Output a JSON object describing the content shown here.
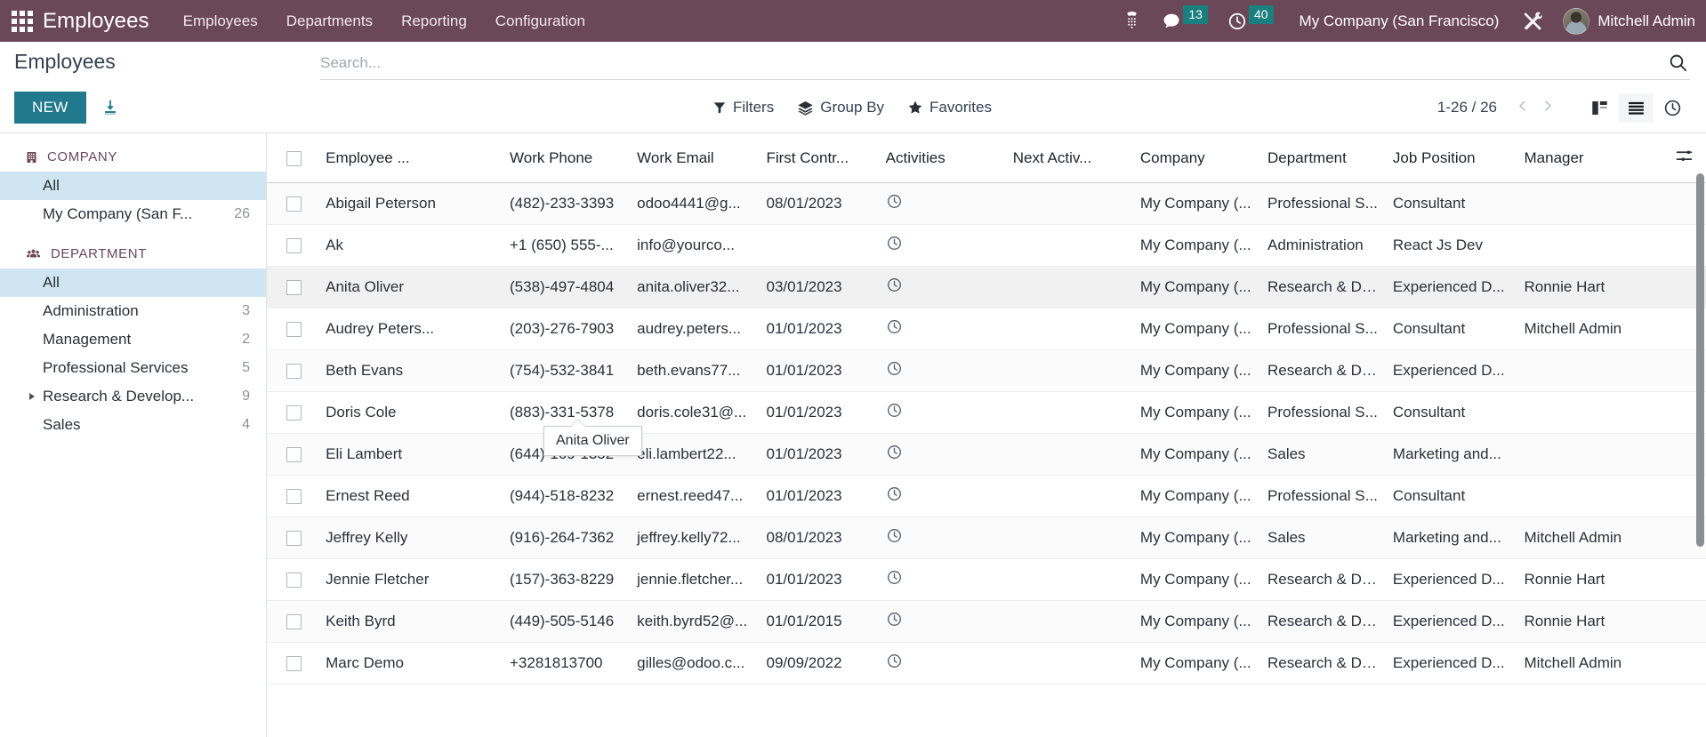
{
  "navbar": {
    "apps_icon": "apps-grid-icon",
    "brand": "Employees",
    "menus": [
      {
        "label": "Employees"
      },
      {
        "label": "Departments"
      },
      {
        "label": "Reporting"
      },
      {
        "label": "Configuration"
      }
    ],
    "systray": {
      "voip_icon": "phone-dialpad-icon",
      "messages_icon": "chat-bubble-icon",
      "messages_count": "13",
      "activities_icon": "clock-icon",
      "activities_count": "40",
      "company": "My Company (San Francisco)",
      "debug_icon": "tools-icon",
      "user_name": "Mitchell Admin",
      "avatar": "user-avatar"
    },
    "accent_purple": "#6b4857",
    "badge_teal": "#1a7f7f"
  },
  "control_panel": {
    "breadcrumb": "Employees",
    "new_label": "NEW",
    "import_icon": "import-download-icon",
    "search": {
      "placeholder": "Search...",
      "value": "",
      "search_icon": "search-icon"
    },
    "filters": [
      {
        "label": "Filters",
        "icon": "filter-funnel-icon"
      },
      {
        "label": "Group By",
        "icon": "layers-icon"
      },
      {
        "label": "Favorites",
        "icon": "star-icon"
      }
    ],
    "pager": {
      "count": "1-26 / 26",
      "prev_icon": "chevron-left-icon",
      "next_icon": "chevron-right-icon"
    },
    "views": [
      {
        "name": "kanban",
        "icon": "kanban-icon",
        "active": false
      },
      {
        "name": "list",
        "icon": "list-icon",
        "active": true
      },
      {
        "name": "activity",
        "icon": "clock-icon",
        "active": false
      }
    ],
    "new_button_color": "#20798c"
  },
  "sidebar": {
    "sections": [
      {
        "title": "COMPANY",
        "icon": "building-icon",
        "items": [
          {
            "label": "All",
            "count": "",
            "active": true,
            "caret": false
          },
          {
            "label": "My Company (San F...",
            "count": "26",
            "active": false,
            "caret": false
          }
        ]
      },
      {
        "title": "DEPARTMENT",
        "icon": "users-group-icon",
        "items": [
          {
            "label": "All",
            "count": "",
            "active": true,
            "caret": false
          },
          {
            "label": "Administration",
            "count": "3",
            "active": false,
            "caret": false
          },
          {
            "label": "Management",
            "count": "2",
            "active": false,
            "caret": false
          },
          {
            "label": "Professional Services",
            "count": "5",
            "active": false,
            "caret": false
          },
          {
            "label": "Research & Develop...",
            "count": "9",
            "active": false,
            "caret": true
          },
          {
            "label": "Sales",
            "count": "4",
            "active": false,
            "caret": false
          }
        ]
      }
    ]
  },
  "list": {
    "columns": [
      {
        "key": "name",
        "label": "Employee ..."
      },
      {
        "key": "phone",
        "label": "Work Phone"
      },
      {
        "key": "email",
        "label": "Work Email"
      },
      {
        "key": "first_contract",
        "label": "First Contr..."
      },
      {
        "key": "activities",
        "label": "Activities"
      },
      {
        "key": "next_activity",
        "label": "Next Activ..."
      },
      {
        "key": "company",
        "label": "Company"
      },
      {
        "key": "department",
        "label": "Department"
      },
      {
        "key": "job_position",
        "label": "Job Position"
      },
      {
        "key": "manager",
        "label": "Manager"
      }
    ],
    "optional_columns_icon": "settings-sliders-icon",
    "activity_icon": "clock-icon",
    "rows": [
      {
        "name": "Abigail Peterson",
        "phone": "(482)-233-3393",
        "email": "odoo4441@g...",
        "first_contract": "08/01/2023",
        "next_activity": "",
        "company": "My Company (...",
        "department": "Professional S...",
        "job_position": "Consultant",
        "manager": ""
      },
      {
        "name": "Ak",
        "phone": "+1 (650) 555-...",
        "email": "info@yourco...",
        "first_contract": "",
        "next_activity": "",
        "company": "My Company (...",
        "department": "Administration",
        "job_position": "React Js Dev",
        "manager": ""
      },
      {
        "name": "Anita Oliver",
        "phone": "(538)-497-4804",
        "email": "anita.oliver32...",
        "first_contract": "03/01/2023",
        "next_activity": "",
        "company": "My Company (...",
        "department": "Research & De...",
        "job_position": "Experienced D...",
        "manager": "Ronnie Hart",
        "hovered": true
      },
      {
        "name": "Audrey Peters...",
        "phone": "(203)-276-7903",
        "email": "audrey.peters...",
        "first_contract": "01/01/2023",
        "next_activity": "",
        "company": "My Company (...",
        "department": "Professional S...",
        "job_position": "Consultant",
        "manager": "Mitchell Admin"
      },
      {
        "name": "Beth Evans",
        "phone": "(754)-532-3841",
        "email": "beth.evans77...",
        "first_contract": "01/01/2023",
        "next_activity": "",
        "company": "My Company (...",
        "department": "Research & De...",
        "job_position": "Experienced D...",
        "manager": ""
      },
      {
        "name": "Doris Cole",
        "phone": "(883)-331-5378",
        "email": "doris.cole31@...",
        "first_contract": "01/01/2023",
        "next_activity": "",
        "company": "My Company (...",
        "department": "Professional S...",
        "job_position": "Consultant",
        "manager": ""
      },
      {
        "name": "Eli Lambert",
        "phone": "(644)-169-1352",
        "email": "eli.lambert22...",
        "first_contract": "01/01/2023",
        "next_activity": "",
        "company": "My Company (...",
        "department": "Sales",
        "job_position": "Marketing and...",
        "manager": ""
      },
      {
        "name": "Ernest Reed",
        "phone": "(944)-518-8232",
        "email": "ernest.reed47...",
        "first_contract": "01/01/2023",
        "next_activity": "",
        "company": "My Company (...",
        "department": "Professional S...",
        "job_position": "Consultant",
        "manager": ""
      },
      {
        "name": "Jeffrey Kelly",
        "phone": "(916)-264-7362",
        "email": "jeffrey.kelly72...",
        "first_contract": "08/01/2023",
        "next_activity": "",
        "company": "My Company (...",
        "department": "Sales",
        "job_position": "Marketing and...",
        "manager": "Mitchell Admin"
      },
      {
        "name": "Jennie Fletcher",
        "phone": "(157)-363-8229",
        "email": "jennie.fletcher...",
        "first_contract": "01/01/2023",
        "next_activity": "",
        "company": "My Company (...",
        "department": "Research & De...",
        "job_position": "Experienced D...",
        "manager": "Ronnie Hart"
      },
      {
        "name": "Keith Byrd",
        "phone": "(449)-505-5146",
        "email": "keith.byrd52@...",
        "first_contract": "01/01/2015",
        "next_activity": "",
        "company": "My Company (...",
        "department": "Research & De...",
        "job_position": "Experienced D...",
        "manager": "Ronnie Hart"
      },
      {
        "name": "Marc Demo",
        "phone": "+3281813700",
        "email": "gilles@odoo.c...",
        "first_contract": "09/09/2022",
        "next_activity": "",
        "company": "My Company (...",
        "department": "Research & De...",
        "job_position": "Experienced D...",
        "manager": "Mitchell Admin"
      }
    ]
  },
  "tooltip": {
    "text": "Anita Oliver"
  }
}
